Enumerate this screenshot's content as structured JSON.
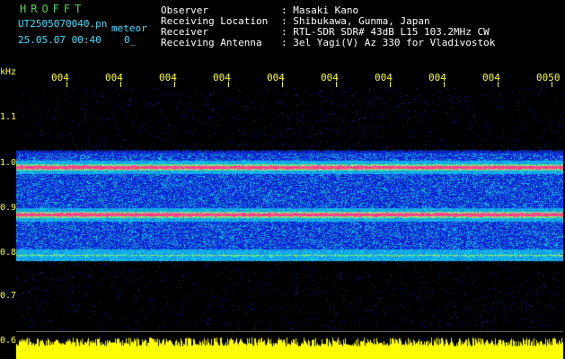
{
  "header": {
    "app_title": "HROFFT",
    "filename": "UT2505070040.pn",
    "mode": "meteor",
    "timestamp": "25.05.07 00:40",
    "count": "0_",
    "labels": [
      "Observer",
      "Receiving Location",
      "Receiver",
      "Receiving Antenna"
    ],
    "values": [
      ": Masaki Kano",
      ": Shibukawa, Gunma, Japan",
      ": RTL-SDR SDR# 43dB L15 103.2MHz CW",
      ": 3el Yagi(V) Az 330 for Vladivostok"
    ]
  },
  "axis": {
    "y_unit": "kHz",
    "y_ticks": [
      "1.1",
      "1.0",
      "0.9",
      "0.8",
      "0.7",
      "0.6"
    ],
    "x_ticks": [
      "004",
      "004",
      "004",
      "004",
      "004",
      "004",
      "004",
      "004",
      "004",
      "0050"
    ]
  },
  "colors": {
    "background": "#000000",
    "label_yellow": "#ffff33",
    "title_green": "#4cd84c",
    "info_cyan": "#3ee0ff",
    "noise_blue": "#1a2ae0",
    "band_red": "#ff2080",
    "baseline_yellow": "#ffff00"
  },
  "spectrogram": {
    "freq_range_khz": [
      0.6,
      1.17
    ],
    "bands_khz": [
      0.985,
      0.875,
      0.78
    ],
    "noise_range_khz": [
      0.77,
      1.03
    ]
  }
}
